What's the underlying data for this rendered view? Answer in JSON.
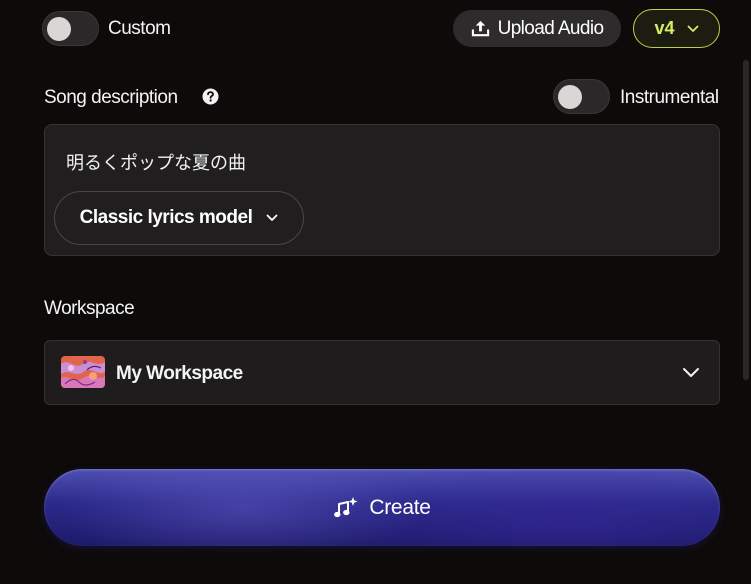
{
  "custom_toggle": {
    "label": "Custom",
    "on": false
  },
  "upload_button": {
    "label": "Upload Audio",
    "icon": "upload-icon"
  },
  "version_select": {
    "value": "v4",
    "icon": "chevron-down-icon",
    "accent": "#d4ec65"
  },
  "song_description": {
    "label": "Song description",
    "help_icon": "question-circle-icon",
    "text": "明るくポップな夏の曲"
  },
  "instrumental_toggle": {
    "label": "Instrumental",
    "on": false
  },
  "lyrics_model": {
    "label": "Classic lyrics model",
    "icon": "chevron-down-icon"
  },
  "workspace": {
    "label": "Workspace",
    "selected": "My Workspace",
    "icon": "chevron-down-icon"
  },
  "create_button": {
    "label": "Create",
    "icon": "music-sparkle-icon",
    "color": "#2b2a8a"
  }
}
